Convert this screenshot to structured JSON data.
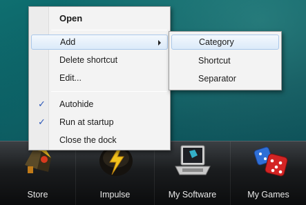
{
  "context_menu": {
    "items": [
      {
        "label": "Open",
        "bold": true
      },
      {
        "label": "Add",
        "has_submenu": true,
        "highlighted": true
      },
      {
        "label": "Delete shortcut"
      },
      {
        "label": "Edit..."
      },
      {
        "label": "Autohide",
        "checked": true
      },
      {
        "label": "Run at startup",
        "checked": true
      },
      {
        "label": "Close the dock"
      }
    ],
    "check_icon": "check-icon",
    "submenu_arrow_icon": "chevron-right-icon"
  },
  "add_submenu": {
    "items": [
      {
        "label": "Category",
        "highlighted": true
      },
      {
        "label": "Shortcut"
      },
      {
        "label": "Separator"
      }
    ]
  },
  "dock": {
    "items": [
      {
        "label": "Store",
        "icon": "store-icon"
      },
      {
        "label": "Impulse",
        "icon": "impulse-icon"
      },
      {
        "label": "My Software",
        "icon": "laptop-icon"
      },
      {
        "label": "My Games",
        "icon": "dice-icon"
      }
    ]
  },
  "colors": {
    "highlight_border": "#a9c7ea",
    "check": "#2a56b8",
    "desktop": "#0b5a60"
  }
}
